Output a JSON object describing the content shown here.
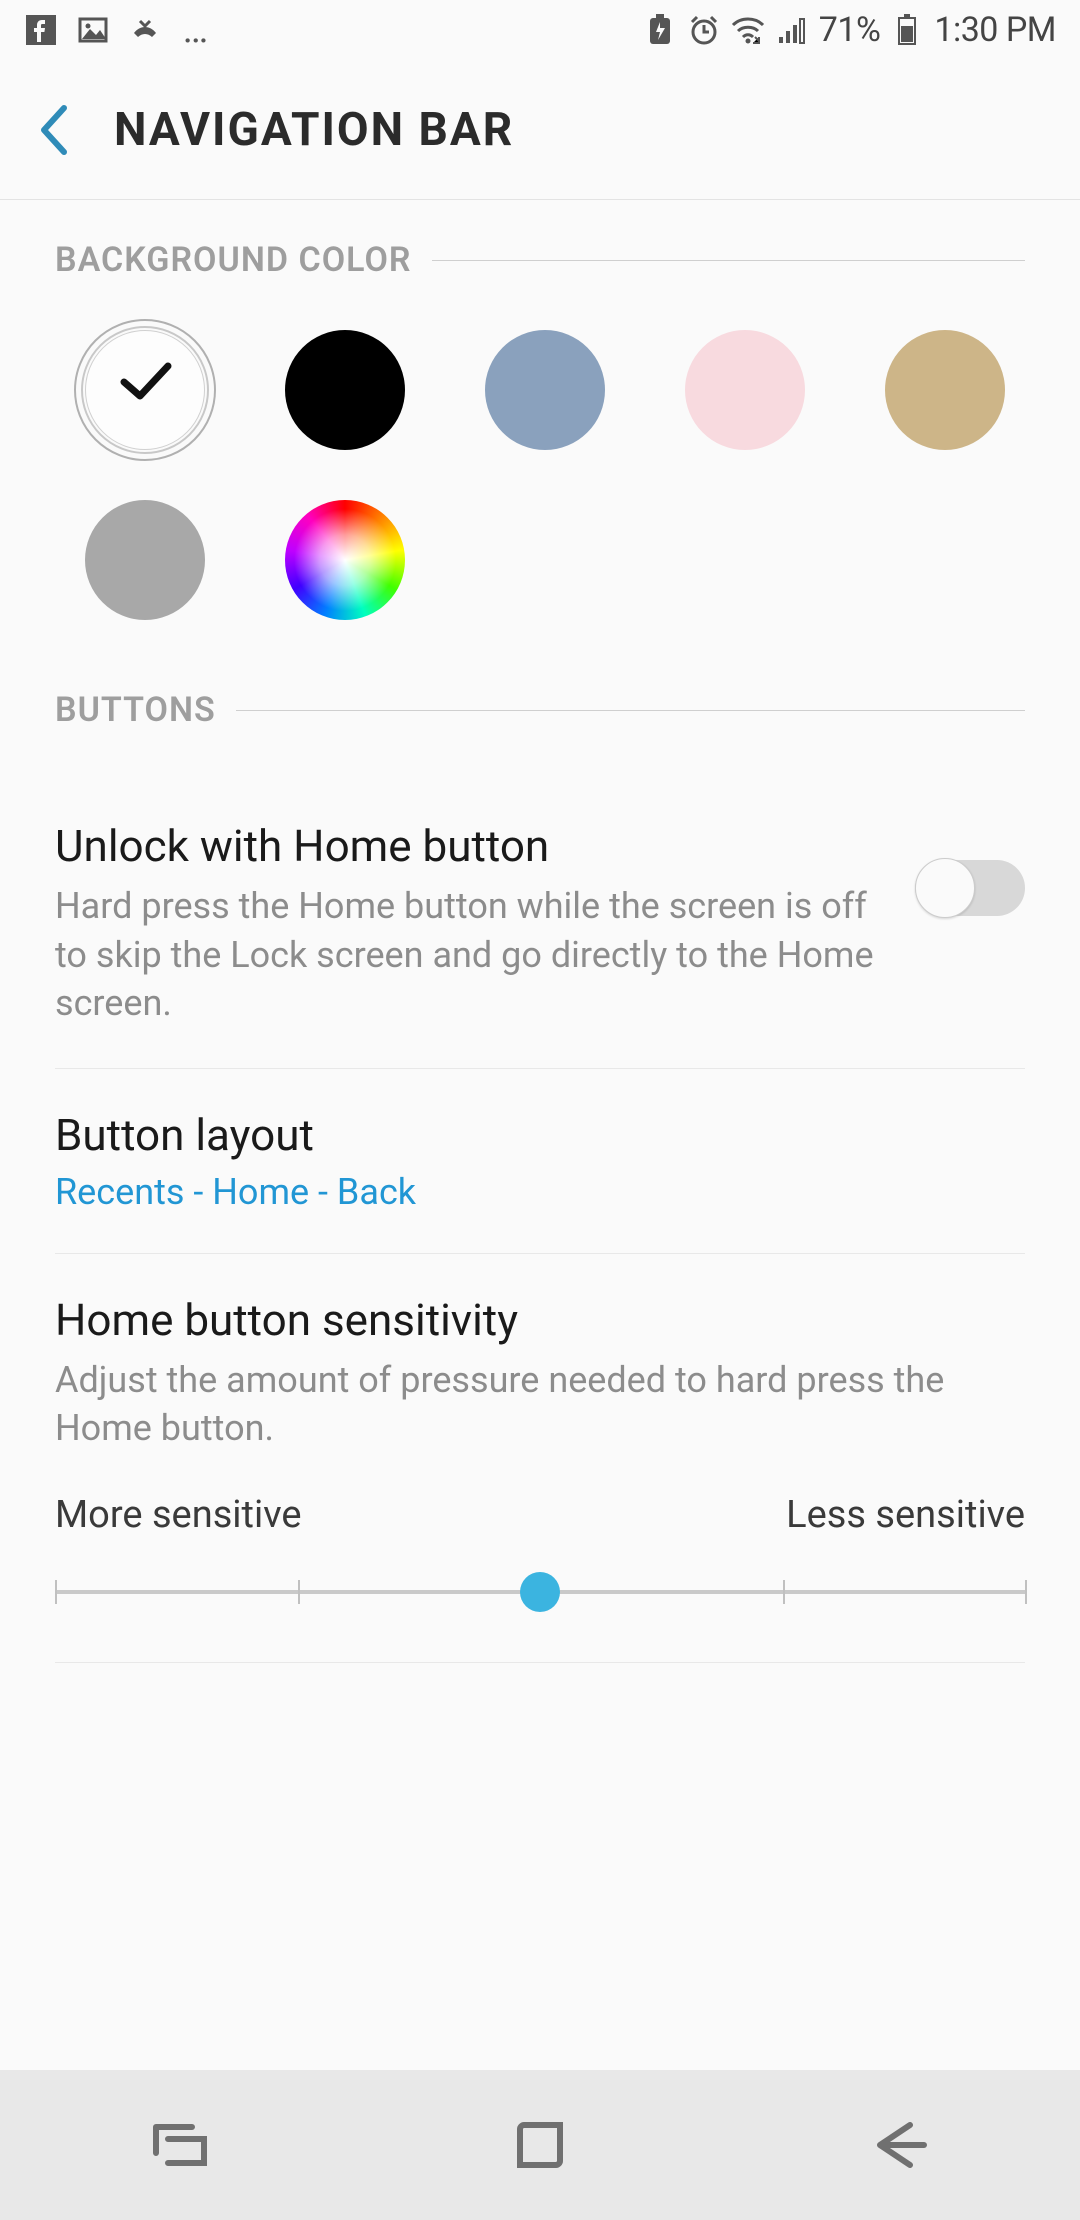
{
  "status": {
    "battery_pct": "71%",
    "time": "1:30 PM"
  },
  "header": {
    "title": "NAVIGATION BAR"
  },
  "sections": {
    "bg_color": {
      "label": "BACKGROUND COLOR",
      "swatches": [
        {
          "name": "white",
          "color": "#fdfdfd",
          "selected": true
        },
        {
          "name": "black",
          "color": "#000000"
        },
        {
          "name": "steel",
          "color": "#8aa1bd"
        },
        {
          "name": "pink",
          "color": "#f8dadf"
        },
        {
          "name": "tan",
          "color": "#cdb588"
        },
        {
          "name": "gray",
          "color": "#a8a8a8"
        },
        {
          "name": "custom",
          "color": "rainbow"
        }
      ]
    },
    "buttons": {
      "label": "BUTTONS",
      "unlock": {
        "title": "Unlock with Home button",
        "desc": "Hard press the Home button while the screen is off to skip the Lock screen and go directly to the Home screen.",
        "on": false
      },
      "layout": {
        "title": "Button layout",
        "value": "Recents - Home - Back"
      },
      "sensitivity": {
        "title": "Home button sensitivity",
        "desc": "Adjust the amount of pressure needed to hard press the Home button.",
        "left_label": "More sensitive",
        "right_label": "Less sensitive",
        "value_pct": 50
      }
    }
  }
}
